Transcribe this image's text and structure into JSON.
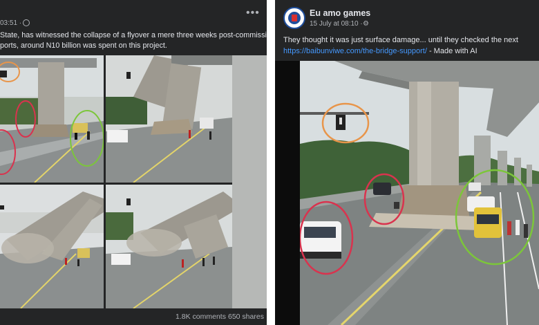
{
  "left_post": {
    "author": "",
    "time": "03:51 ·",
    "more_label": "•••",
    "text_line1": "State, has witnessed the collapse of a flyover a mere three weeks post-commissioning.",
    "text_line2": "ports, around N10 billion was spent on this project.",
    "comments": "1.8K comments",
    "shares": "650 shares"
  },
  "right_post": {
    "author": "Eu amo games",
    "time": "15 July at 08:10 ·",
    "gear_icon": "⚙",
    "caption_text": "They thought it was just surface damage... until they checked the next",
    "link": "https://baibunviwe.com/the-bridge-support/",
    "link_suffix": " - Made with AI"
  },
  "colors": {
    "post_bg": "#242526",
    "text_primary": "#e4e6eb",
    "text_secondary": "#b0b3b8",
    "link": "#4599ff",
    "circle_orange": "#e8954a",
    "circle_red": "#d9334e",
    "circle_green": "#7cc63a"
  },
  "icons": [
    "globe-icon",
    "more-options-icon",
    "settings-icon",
    "page-avatar"
  ]
}
